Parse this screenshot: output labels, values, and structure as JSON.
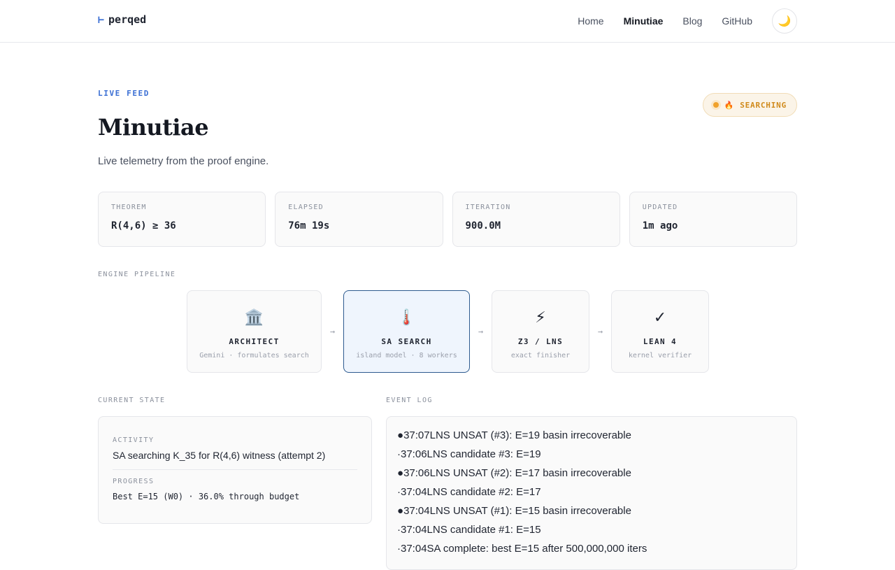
{
  "header": {
    "brand_mark": "⊢",
    "brand_name": "perqed",
    "nav": [
      {
        "label": "Home"
      },
      {
        "label": "Minutiae"
      },
      {
        "label": "Blog"
      },
      {
        "label": "GitHub"
      }
    ],
    "theme_icon": "🌙"
  },
  "hero": {
    "eyebrow": "LIVE FEED",
    "title": "Minutiae",
    "subtitle": "Live telemetry from the proof engine.",
    "status_icon": "🔥",
    "status_label": "SEARCHING"
  },
  "stats": [
    {
      "label": "THEOREM",
      "value": "R(4,6) ≥ 36"
    },
    {
      "label": "ELAPSED",
      "value": "76m 19s"
    },
    {
      "label": "ITERATION",
      "value": "900.0M"
    },
    {
      "label": "UPDATED",
      "value": "1m ago"
    }
  ],
  "pipeline": {
    "label": "ENGINE PIPELINE",
    "arrow": "→",
    "stages": [
      {
        "icon": "🏛️",
        "name": "ARCHITECT",
        "desc": "Gemini · formulates search"
      },
      {
        "icon": "🌡️",
        "name": "SA SEARCH",
        "desc": "island model · 8 workers"
      },
      {
        "icon": "⚡",
        "name": "Z3 / LNS",
        "desc": "exact finisher"
      },
      {
        "icon": "✓",
        "name": "LEAN 4",
        "desc": "kernel verifier"
      }
    ]
  },
  "current_state": {
    "label": "CURRENT STATE",
    "activity_label": "ACTIVITY",
    "activity": "SA searching K_35 for R(4,6) witness (attempt 2)",
    "progress_label": "PROGRESS",
    "progress": "Best E=15 (W0) · 36.0% through budget"
  },
  "event_log": {
    "label": "EVENT LOG",
    "entries": [
      {
        "marker": "●",
        "time": "37:07",
        "text": "LNS UNSAT (#3): E=19 basin irrecoverable"
      },
      {
        "marker": "·",
        "time": "37:06",
        "text": "LNS candidate #3: E=19"
      },
      {
        "marker": "●",
        "time": "37:06",
        "text": "LNS UNSAT (#2): E=17 basin irrecoverable"
      },
      {
        "marker": "·",
        "time": "37:04",
        "text": "LNS candidate #2: E=17"
      },
      {
        "marker": "●",
        "time": "37:04",
        "text": "LNS UNSAT (#1): E=15 basin irrecoverable"
      },
      {
        "marker": "·",
        "time": "37:04",
        "text": "LNS candidate #1: E=15"
      },
      {
        "marker": "·",
        "time": "37:04",
        "text": "SA complete: best E=15 after 500,000,000 iters"
      }
    ]
  },
  "colors": {
    "accent": "#3b6fd4",
    "active_stage_border": "#2e5b8f",
    "status": "#d08a1c"
  }
}
